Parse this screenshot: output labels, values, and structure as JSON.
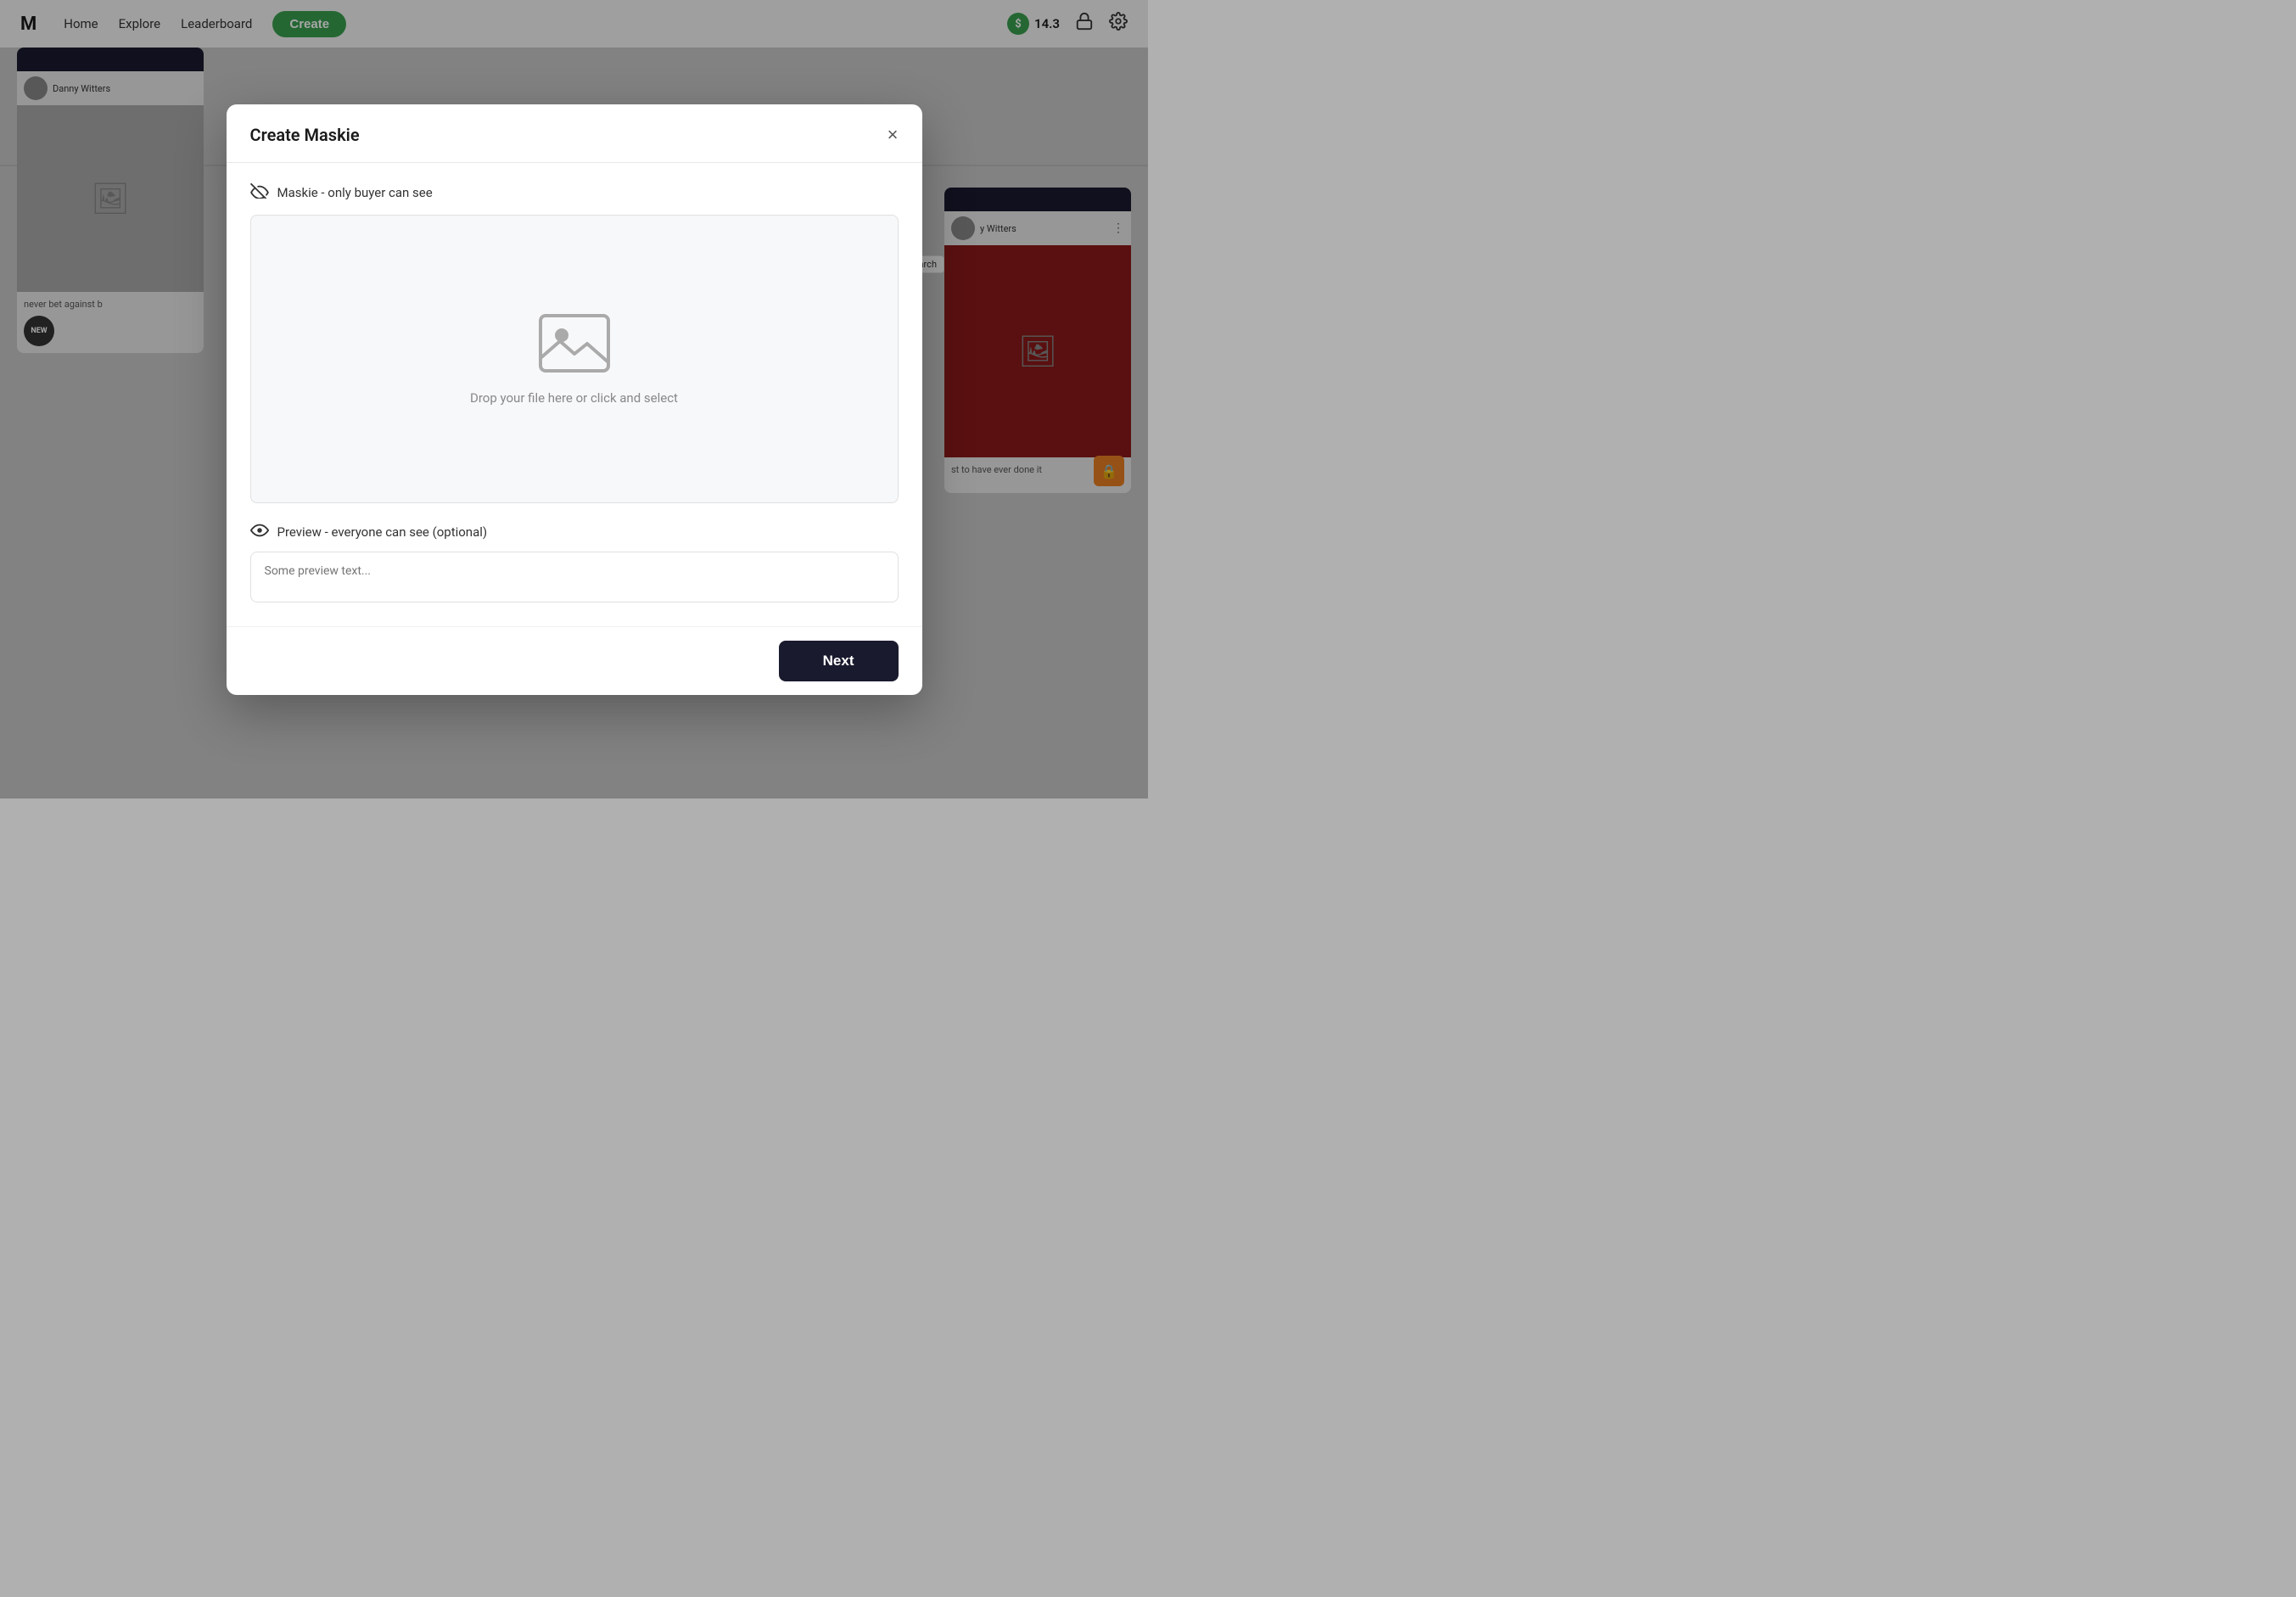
{
  "nav": {
    "logo": "M",
    "home": "Home",
    "explore": "Explore",
    "leaderboard": "Leaderboard",
    "create": "Create",
    "credits": "14.3"
  },
  "bg": {
    "user1": "Danny Witters",
    "user2": "y Witters",
    "card1_text": "never bet against b",
    "card2_text": "st to have ever done it",
    "badge_new": "NEW",
    "tooltip": "rent-search"
  },
  "modal": {
    "title": "Create Maskie",
    "close_label": "×",
    "maskie_label": "Maskie - only buyer can see",
    "drop_text": "Drop your file here or click and select",
    "preview_label": "Preview - everyone can see (optional)",
    "preview_placeholder": "Some preview text...",
    "next_button": "Next"
  }
}
